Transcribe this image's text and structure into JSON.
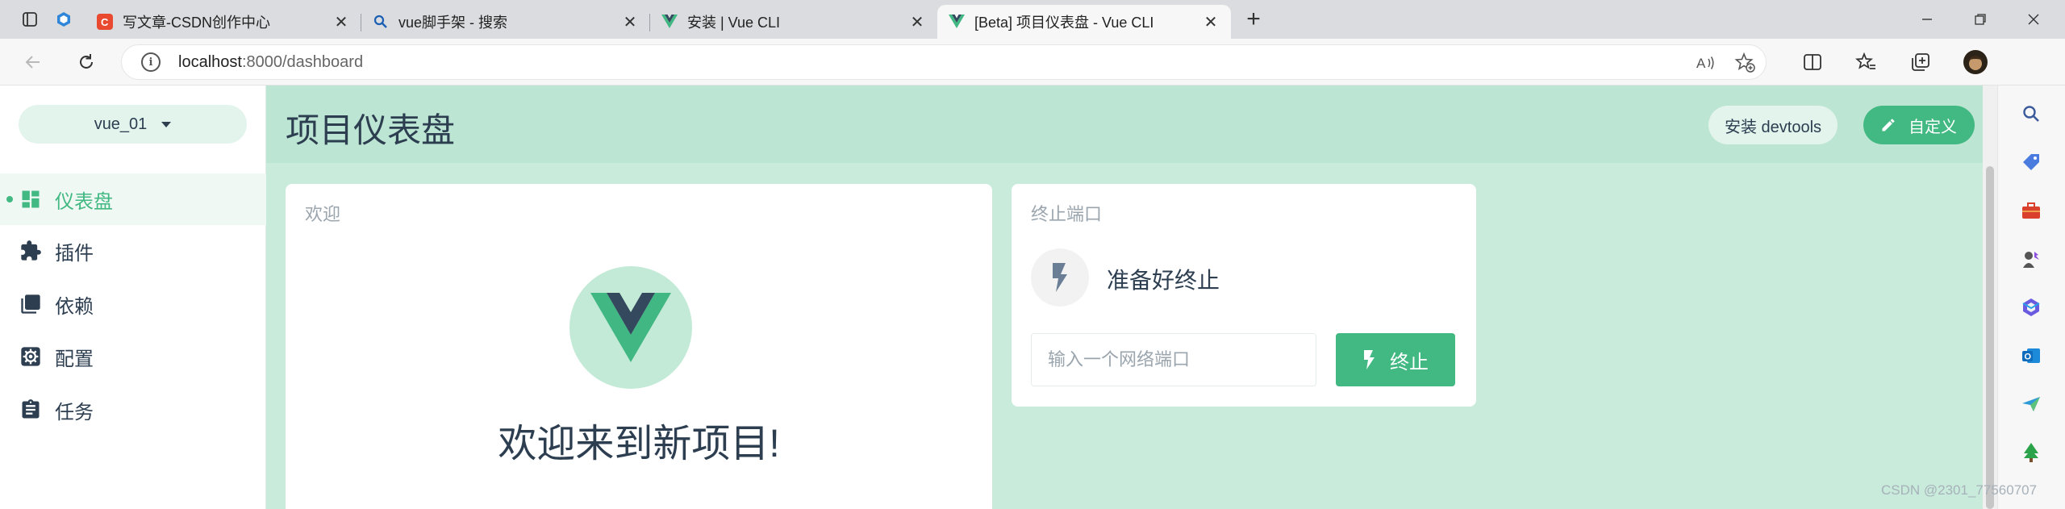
{
  "browser": {
    "tabs": [
      {
        "title": "写文章-CSDN创作中心",
        "icon": "csdn-favicon",
        "active": false
      },
      {
        "title": "vue脚手架 - 搜索",
        "icon": "bing-search-favicon",
        "active": false
      },
      {
        "title": "安装 | Vue CLI",
        "icon": "vue-favicon",
        "active": false
      },
      {
        "title": "[Beta] 项目仪表盘 - Vue CLI",
        "icon": "vue-favicon",
        "active": true
      }
    ],
    "address": {
      "host": "localhost",
      "path": ":8000/dashboard"
    }
  },
  "sidebar": {
    "project_name": "vue_01",
    "items": [
      {
        "label": "仪表盘",
        "icon": "dashboard-icon",
        "active": true
      },
      {
        "label": "插件",
        "icon": "puzzle-icon",
        "active": false
      },
      {
        "label": "依赖",
        "icon": "library-books-icon",
        "active": false
      },
      {
        "label": "配置",
        "icon": "settings-icon",
        "active": false
      },
      {
        "label": "任务",
        "icon": "clipboard-icon",
        "active": false
      }
    ]
  },
  "header": {
    "title": "项目仪表盘",
    "devtools_label": "安装 devtools",
    "customize_label": "自定义"
  },
  "welcome_card": {
    "title": "欢迎",
    "message": "欢迎来到新项目!"
  },
  "kill_port_card": {
    "title": "终止端口",
    "status": "准备好终止",
    "input_placeholder": "输入一个网络端口",
    "input_value": "",
    "button_label": "终止"
  },
  "watermark": "CSDN @2301_77560707",
  "colors": {
    "accent": "#42b983",
    "text": "#2c3e50",
    "header_bg": "#bde5d3",
    "main_bg": "#c9ebdb",
    "muted": "#9aa5ae"
  }
}
